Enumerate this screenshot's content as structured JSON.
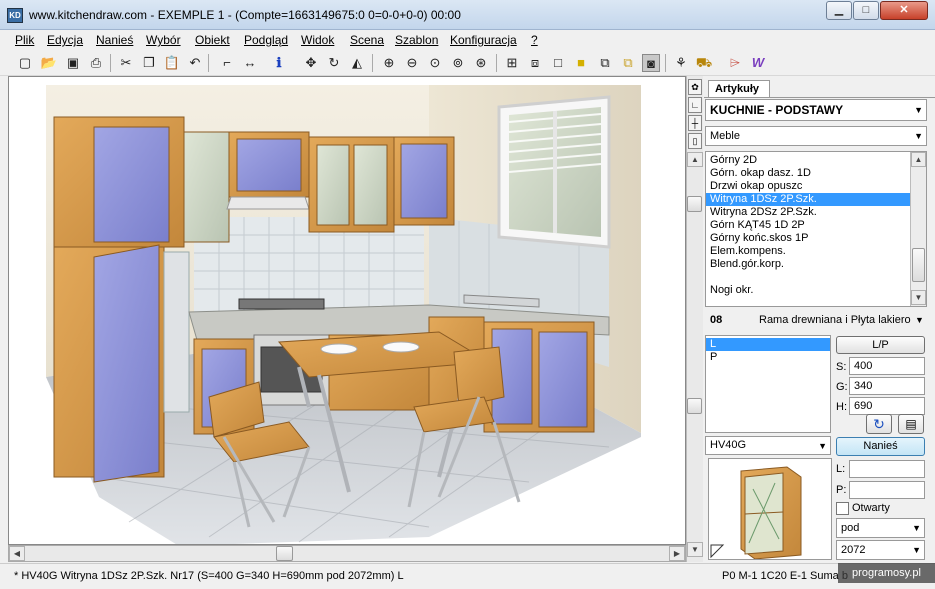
{
  "window": {
    "title": "www.kitchendraw.com - EXEMPLE 1 - (Compte=1663149675:0 0=0-0+0-0) 00:00",
    "app_icon": "KD"
  },
  "window_controls": {
    "minimize": "▁",
    "maximize": "□",
    "close": "✕"
  },
  "menu": [
    {
      "label": "Plik"
    },
    {
      "label": "Edycja"
    },
    {
      "label": "Nanieś"
    },
    {
      "label": "Wybór"
    },
    {
      "label": "Obiekt"
    },
    {
      "label": "Podgląd"
    },
    {
      "label": "Widok"
    },
    {
      "label": "Scena"
    },
    {
      "label": "Szablon"
    },
    {
      "label": "Konfiguracja"
    },
    {
      "label": "?"
    }
  ],
  "toolbar_icons": [
    "new-file",
    "open-folder",
    "save",
    "print",
    "cut",
    "copy",
    "paste",
    "undo",
    "measure",
    "dimension",
    "info",
    "move",
    "rotate",
    "mirror",
    "zoom-in",
    "zoom-out",
    "zoom-window",
    "zoom-all",
    "zoom-previous",
    "plan-view",
    "elevation-view",
    "wireframe-view",
    "solid-view",
    "box-view",
    "render-view",
    "camera-view",
    "tool-a",
    "tool-b",
    "tool-c",
    "tool-d"
  ],
  "panel": {
    "tab_label": "Artykuły",
    "catalog": "KUCHNIE - PODSTAWY",
    "category": "Meble",
    "items": [
      "Górny 2D",
      "Górn. okap dasz. 1D",
      "Drzwi okap opuszc",
      "Witryna 1DSz 2P.Szk.",
      "Witryna 2DSz 2P.Szk.",
      "Górn KĄT45 1D 2P",
      "Górny końc.skos 1P",
      "Elem.kompens.",
      "Blend.gór.korp.",
      "",
      "Nogi okr."
    ],
    "selected_item_index": 3,
    "model_code": "08",
    "model_name": "Rama drewniana i Płyta lakiero",
    "hinge_options": [
      "L",
      "P"
    ],
    "selected_hinge_index": 0,
    "lp_button": "L/P",
    "dims": {
      "s_label": "S:",
      "s_value": "400",
      "g_label": "G:",
      "g_value": "340",
      "h_label": "H:",
      "h_value": "690"
    },
    "ref_code": "HV40G",
    "place_button": "Nanieś",
    "l_label": "L:",
    "p_label": "P:",
    "open_label": "Otwarty",
    "position": "pod",
    "height_value": "2072"
  },
  "status": {
    "left": "* HV40G  Witryna 1DSz 2P.Szk. Nr17  (S=400 G=340 H=690mm pod 2072mm) L",
    "right": "P0 M-1 1C20 E-1 Suma b",
    "watermark": "programosy.pl"
  },
  "colors": {
    "cabinet_wood": "#d69a45",
    "door_blue": "#8c90d8",
    "selection": "#3399ff",
    "floor": "#c9ccd1",
    "tiles": "#dde3e6"
  }
}
